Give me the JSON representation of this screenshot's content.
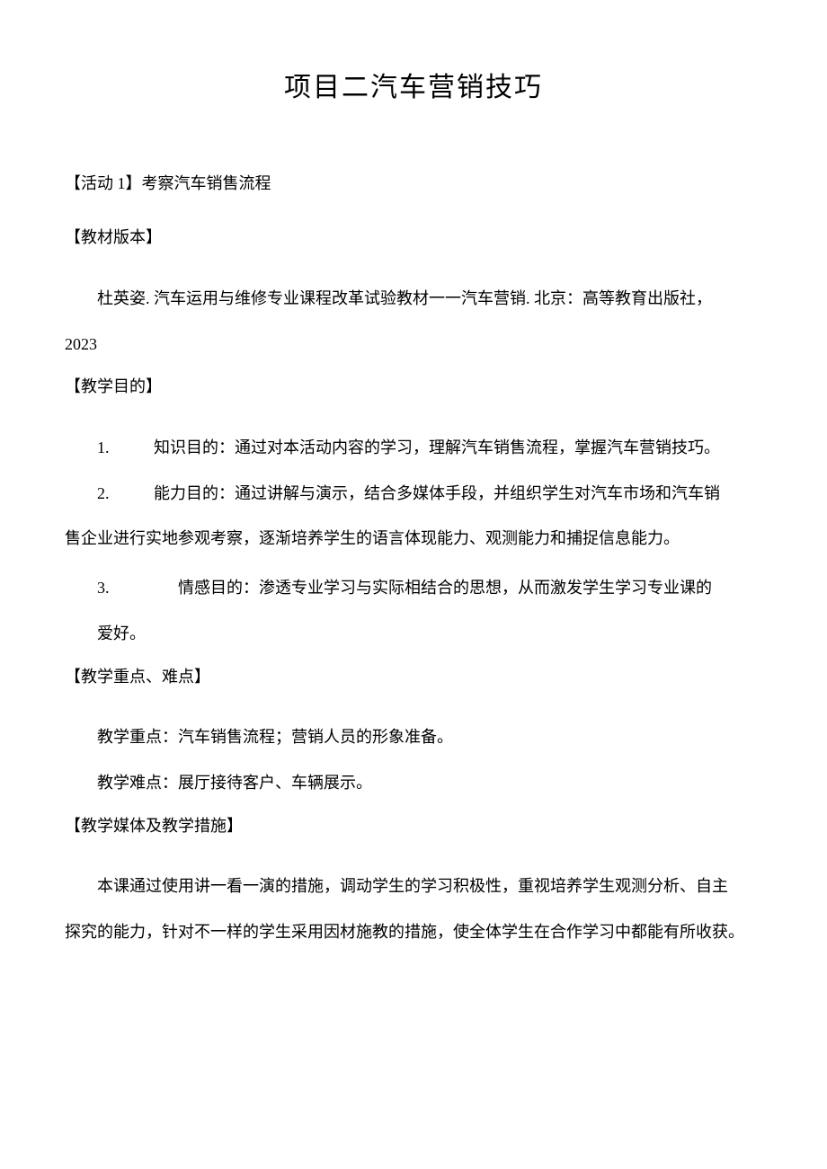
{
  "title": "项目二汽车营销技巧",
  "activity_heading": "【活动 1】考察汽车销售流程",
  "textbook_heading": "【教材版本】",
  "textbook_body": "杜英姿. 汽车运用与维修专业课程改革试验教材一一汽车营销. 北京：高等教育出版社，",
  "textbook_year": "2023",
  "goals_heading": "【教学目的】",
  "goal1_num": "1.",
  "goal1_text": "知识目的：通过对本活动内容的学习，理解汽车销售流程，掌握汽车营销技巧。",
  "goal2_num": "2.",
  "goal2_text": "能力目的：通过讲解与演示，结合多媒体手段，并组织学生对汽车市场和汽车销",
  "goal2_cont": "售企业进行实地参观考察，逐渐培养学生的语言体现能力、观测能力和捕捉信息能力。",
  "goal3_num": "3.",
  "goal3_text": "情感目的：渗透专业学习与实际相结合的思想，从而激发学生学习专业课的",
  "goal3_cont": "爱好。",
  "focus_heading": "【教学重点、难点】",
  "focus_text1": "教学重点：汽车销售流程；营销人员的形象准备。",
  "focus_text2": "教学难点：展厅接待客户、车辆展示。",
  "media_heading": "【教学媒体及教学措施】",
  "media_body": "本课通过使用讲一看一演的措施，调动学生的学习积极性，重视培养学生观测分析、自主",
  "media_cont": "探究的能力，针对不一样的学生采用因材施教的措施，使全体学生在合作学习中都能有所收获。"
}
